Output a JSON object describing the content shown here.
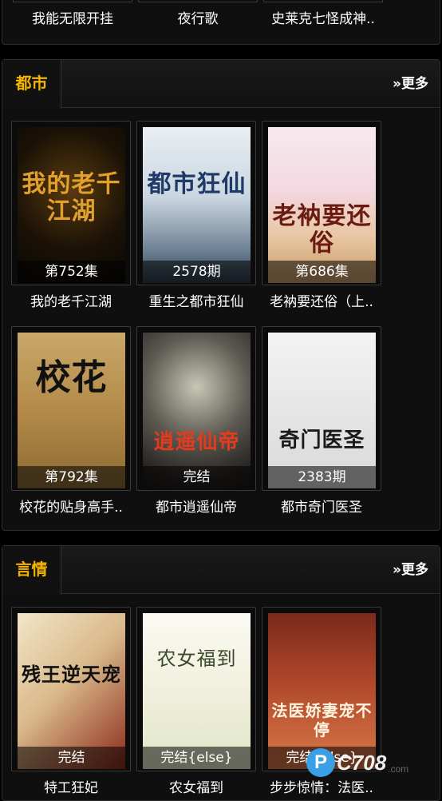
{
  "top_section": {
    "names": [
      "我能无限开挂",
      "夜行歌",
      "史莱克七怪成神.."
    ]
  },
  "sections": [
    {
      "title": "都市",
      "more": "»更多",
      "books": [
        {
          "name": "我的老千江湖",
          "badge": "第752集",
          "cover_text": "我的老千江湖"
        },
        {
          "name": "重生之都市狂仙",
          "badge": "2578期",
          "cover_text": "都市狂仙"
        },
        {
          "name": "老衲要还俗（上..",
          "badge": "第686集",
          "cover_text": "老衲要还俗"
        },
        {
          "name": "校花的贴身高手..",
          "badge": "第792集",
          "cover_text": "校花"
        },
        {
          "name": "都市逍遥仙帝",
          "badge": "完结",
          "cover_text": "逍遥仙帝"
        },
        {
          "name": "都市奇门医圣",
          "badge": "2383期",
          "cover_text": "奇门医圣"
        }
      ]
    },
    {
      "title": "言情",
      "more": "»更多",
      "books": [
        {
          "name": "特工狂妃",
          "badge": "完结",
          "cover_text": "残王逆天宠"
        },
        {
          "name": "农女福到",
          "badge": "完结{else}",
          "cover_text": "农女福到"
        },
        {
          "name": "步步惊情：法医..",
          "badge": "完结{else}",
          "cover_text": "法医娇妻宠不停"
        }
      ]
    }
  ],
  "watermark": {
    "logo_letter": "P",
    "text": "C708",
    "suffix": ".com"
  },
  "colors": {
    "accent": "#f5b400",
    "background": "#000000",
    "panel": "#0f0f0f",
    "border": "#2e2e2e"
  }
}
